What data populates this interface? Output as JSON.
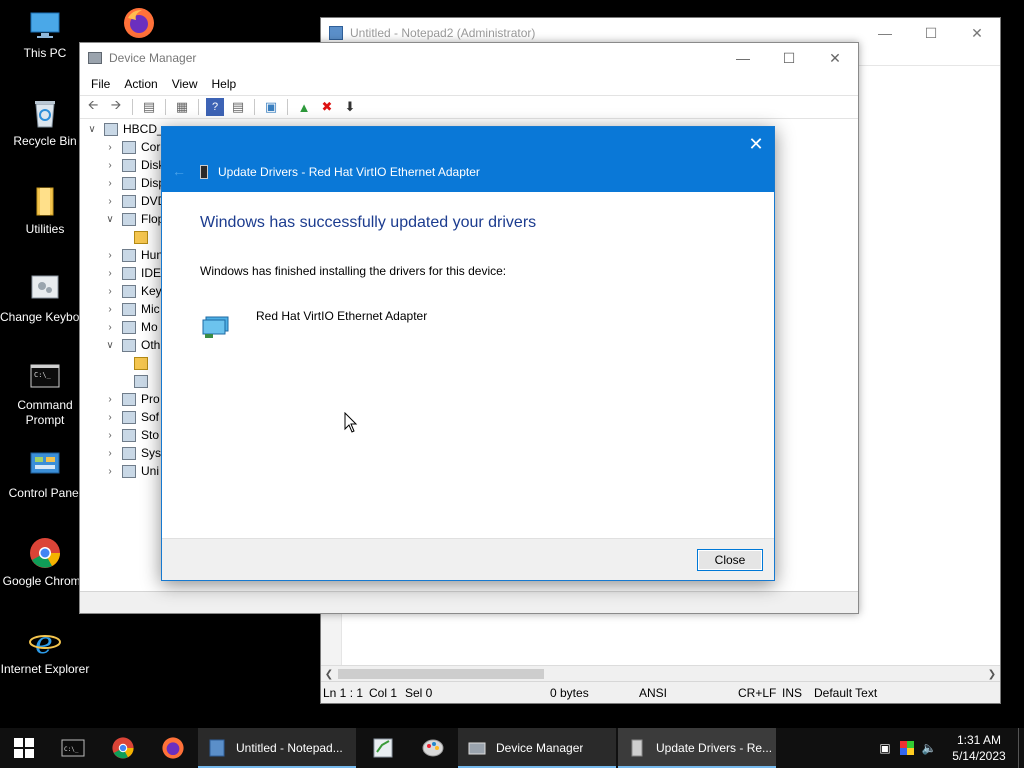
{
  "desktop": {
    "icons": [
      {
        "label": "This PC"
      },
      {
        "label": "Recycle Bin"
      },
      {
        "label": "Utilities"
      },
      {
        "label": "Change Keyboard Layout"
      },
      {
        "label": "Command Prompt"
      },
      {
        "label": "Control Panel"
      },
      {
        "label": "Google Chrome"
      },
      {
        "label": "Internet Explorer"
      }
    ]
  },
  "notepad": {
    "title": "Untitled - Notepad2 (Administrator)",
    "status": {
      "position": "Ln 1 : 1",
      "col": "Col 1",
      "sel": "Sel 0",
      "size": "0 bytes",
      "encoding": "ANSI",
      "line_ending": "CR+LF",
      "ins": "INS",
      "scheme": "Default Text"
    }
  },
  "device_manager": {
    "title": "Device Manager",
    "menu": [
      "File",
      "Action",
      "View",
      "Help"
    ],
    "tree": {
      "root": "HBCD_",
      "items": [
        "Cor",
        "Disk",
        "Disp",
        "DVD",
        "Flop",
        "Hun",
        "IDE",
        "Key",
        "Mic",
        "Mo",
        "Oth",
        "Pro",
        "Sof",
        "Sto",
        "Syst",
        "Uni"
      ]
    }
  },
  "dialog": {
    "title": "Update Drivers - Red Hat VirtIO Ethernet Adapter",
    "heading": "Windows has successfully updated your drivers",
    "body": "Windows has finished installing the drivers for this device:",
    "device_name": "Red Hat VirtIO Ethernet Adapter",
    "close_label": "Close"
  },
  "taskbar": {
    "tasks": [
      {
        "label": "Untitled - Notepad..."
      },
      {
        "label": "Device Manager"
      },
      {
        "label": "Update Drivers - Re..."
      }
    ],
    "clock": {
      "time": "1:31 AM",
      "date": "5/14/2023"
    }
  },
  "colors": {
    "dialog_header": "#0a78d7",
    "heading_text": "#1c3c8f",
    "taskbar": "#101010",
    "accent": "#76b9ed"
  }
}
